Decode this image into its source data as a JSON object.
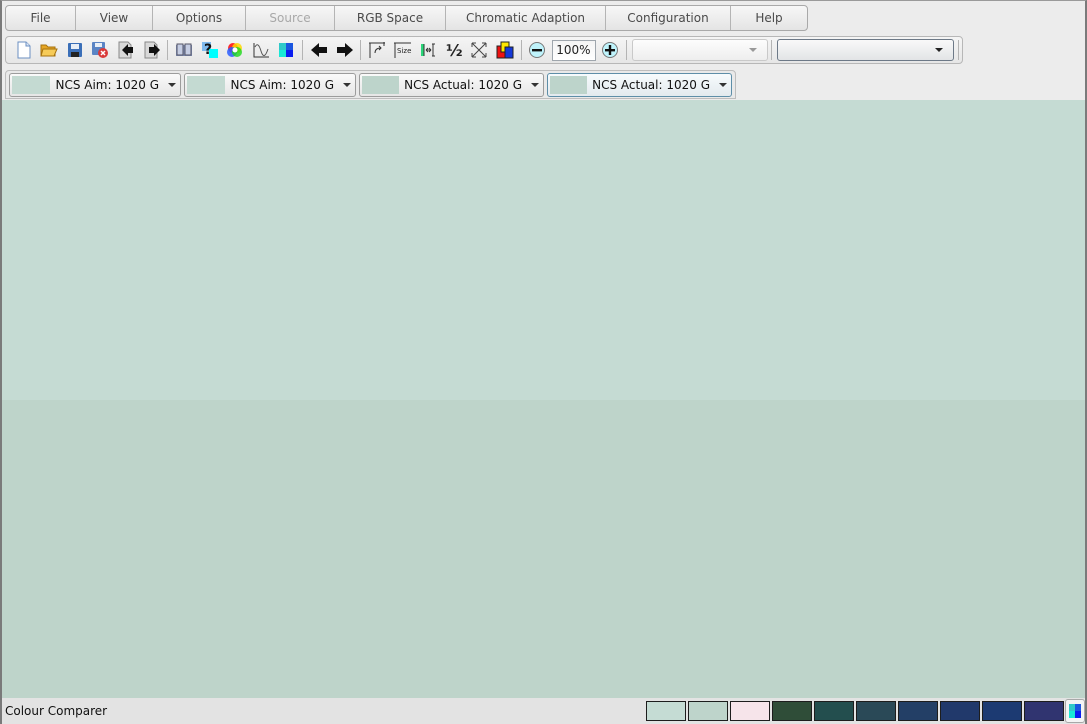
{
  "menu": [
    {
      "label": "File",
      "enabled": true
    },
    {
      "label": "View",
      "enabled": true
    },
    {
      "label": "Options",
      "enabled": true
    },
    {
      "label": "Source",
      "enabled": false
    },
    {
      "label": "RGB Space",
      "enabled": true
    },
    {
      "label": "Chromatic Adaption",
      "enabled": true
    },
    {
      "label": "Configuration",
      "enabled": true
    },
    {
      "label": "Help",
      "enabled": true
    }
  ],
  "toolbar": {
    "icons": [
      "new-file-icon",
      "open-folder-icon",
      "save-icon",
      "delete-file-icon",
      "import-icon",
      "export-icon",
      "book-icon",
      "help-icon",
      "color-wheel-icon",
      "spectral-curve-icon",
      "swatch-grid-icon",
      "back-arrow-icon",
      "forward-arrow-icon",
      "rotate-icon",
      "size-icon",
      "fit-width-icon",
      "half-icon",
      "fullscreen-icon",
      "overlap-colors-icon",
      "zoom-out-icon",
      "zoom-in-icon"
    ],
    "zoom_value": "100%",
    "combo1_value": "",
    "combo2_value": ""
  },
  "tabs": [
    {
      "label": "NCS Aim: 1020 G",
      "swatch": "#c4dad2",
      "selected": false
    },
    {
      "label": "NCS Aim: 1020 G",
      "swatch": "#c4dad2",
      "selected": false
    },
    {
      "label": "NCS Actual: 1020 G",
      "swatch": "#bdd4cb",
      "selected": false
    },
    {
      "label": "NCS Actual: 1020 G",
      "swatch": "#bdd4cb",
      "selected": true
    }
  ],
  "content": {
    "top_color": "#c5dbd3",
    "bottom_color": "#bed4ca"
  },
  "status": {
    "text": "Colour Comparer",
    "palette": [
      "#c5dcd4",
      "#bed4cb",
      "#f6e4ea",
      "#2f4d38",
      "#234e4e",
      "#2a4957",
      "#233f66",
      "#21396b",
      "#1c3a72",
      "#303470"
    ]
  }
}
